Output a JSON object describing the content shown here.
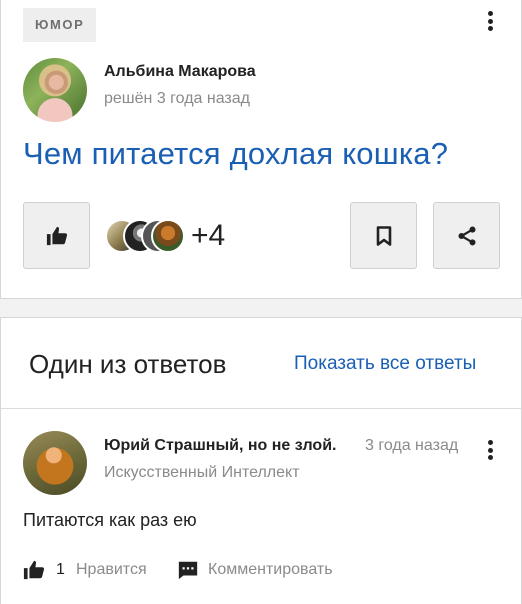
{
  "question": {
    "category": "ЮМОР",
    "author_name": "Альбина Макарова",
    "solved_time": "решён 3 года назад",
    "title": "Чем питается дохлая кошка?",
    "likers_more": "+4",
    "icons": {
      "menu": "more-vertical-icon",
      "like": "thumbs-up-icon",
      "bookmark": "bookmark-icon",
      "share": "share-icon"
    }
  },
  "answers": {
    "heading": "Один из ответов",
    "show_all": "Показать все ответы",
    "item": {
      "author_name": "Юрий Страшный, но не злой.",
      "time": "3 года назад",
      "rank": "Искусственный Интеллект",
      "text": "Питаются как раз ею",
      "like_count": "1",
      "like_label": "Нравится",
      "comment_label": "Комментировать"
    }
  },
  "colors": {
    "link_blue": "#1a5fb4",
    "muted_gray": "#8a8a8a",
    "button_bg": "#efefef"
  }
}
